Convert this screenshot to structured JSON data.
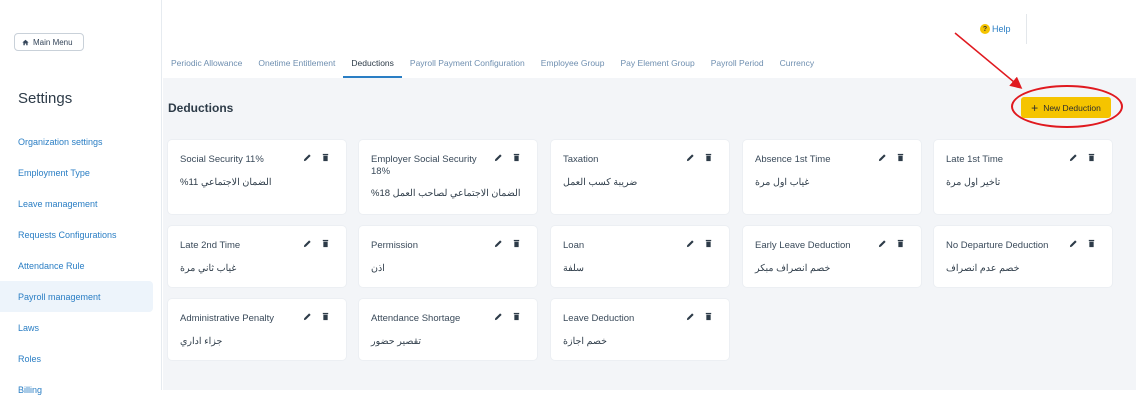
{
  "sidebar": {
    "main_menu_label": "Main Menu",
    "title": "Settings",
    "items": [
      {
        "label": "Organization settings"
      },
      {
        "label": "Employment Type"
      },
      {
        "label": "Leave management"
      },
      {
        "label": "Requests Configurations"
      },
      {
        "label": "Attendance Rule"
      },
      {
        "label": "Payroll management"
      },
      {
        "label": "Laws"
      },
      {
        "label": "Roles"
      },
      {
        "label": "Billing"
      }
    ],
    "active_index": 5
  },
  "header": {
    "help_label": "Help",
    "tabs": [
      {
        "label": "Periodic Allowance"
      },
      {
        "label": "Onetime Entitlement"
      },
      {
        "label": "Deductions"
      },
      {
        "label": "Payroll Payment Configuration"
      },
      {
        "label": "Employee Group"
      },
      {
        "label": "Pay Element Group"
      },
      {
        "label": "Payroll Period"
      },
      {
        "label": "Currency"
      }
    ],
    "active_tab_index": 2
  },
  "main": {
    "heading": "Deductions",
    "new_button_label": "New Deduction",
    "cards": [
      {
        "title": "Social Security 11%",
        "subtitle": "%الضمان الاجتماعي 11"
      },
      {
        "title": "Employer Social Security 18%",
        "subtitle": "%الضمان الاجتماعي لصاحب العمل 18"
      },
      {
        "title": "Taxation",
        "subtitle": "ضريبة كسب العمل"
      },
      {
        "title": "Absence 1st Time",
        "subtitle": "غياب اول مرة"
      },
      {
        "title": "Late 1st Time",
        "subtitle": "تاخير اول مرة"
      },
      {
        "title": "Late 2nd Time",
        "subtitle": "غياب ثاني مرة"
      },
      {
        "title": "Permission",
        "subtitle": "اذن"
      },
      {
        "title": "Loan",
        "subtitle": "سلفة"
      },
      {
        "title": "Early Leave Deduction",
        "subtitle": "خصم انصراف مبكر"
      },
      {
        "title": "No Departure Deduction",
        "subtitle": "خصم عدم انصراف"
      },
      {
        "title": "Administrative Penalty",
        "subtitle": "جزاء اداري"
      },
      {
        "title": "Attendance Shortage",
        "subtitle": "تقصير حضور"
      },
      {
        "title": "Leave Deduction",
        "subtitle": "خصم اجازة"
      }
    ]
  },
  "colors": {
    "accent": "#2a7ec4",
    "button": "#f5c400",
    "annotation": "#e0191f"
  }
}
